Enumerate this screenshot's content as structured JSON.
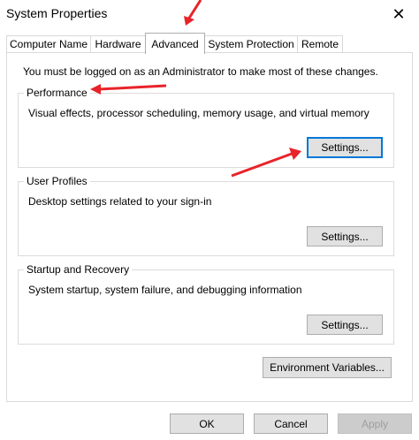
{
  "window": {
    "title": "System Properties",
    "close_symbol": "✕"
  },
  "tabs": [
    "Computer Name",
    "Hardware",
    "Advanced",
    "System Protection",
    "Remote"
  ],
  "active_tab": "Advanced",
  "advanced": {
    "admin_notice": "You must be logged on as an Administrator to make most of these changes.",
    "performance": {
      "title": "Performance",
      "description": "Visual effects, processor scheduling, memory usage, and virtual memory",
      "button": "Settings..."
    },
    "user_profiles": {
      "title": "User Profiles",
      "description": "Desktop settings related to your sign-in",
      "button": "Settings..."
    },
    "startup_recovery": {
      "title": "Startup and Recovery",
      "description": "System startup, system failure, and debugging information",
      "button": "Settings..."
    },
    "env_button": "Environment Variables..."
  },
  "footer": {
    "ok": "OK",
    "cancel": "Cancel",
    "apply": "Apply"
  },
  "colors": {
    "annotation_arrow": "#e8232a",
    "focus_border": "#0078d7"
  }
}
